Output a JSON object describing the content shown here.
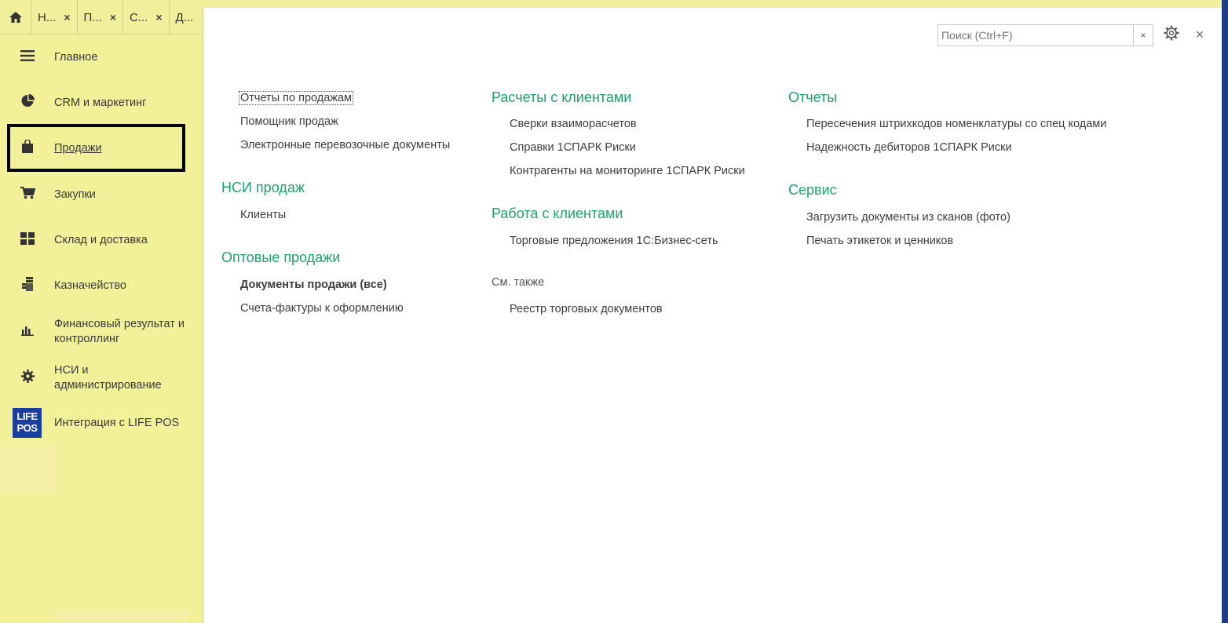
{
  "tabs": [
    {
      "label": "Н...",
      "close": "×"
    },
    {
      "label": "П...",
      "close": "×"
    },
    {
      "label": "С...",
      "close": "×"
    },
    {
      "label": "Д..."
    }
  ],
  "sidebar": {
    "items": [
      {
        "label": "Главное",
        "icon": "menu-icon"
      },
      {
        "label": "CRM и маркетинг",
        "icon": "pie-chart-icon"
      },
      {
        "label": "Продажи",
        "icon": "shopping-bag-icon",
        "active": true
      },
      {
        "label": "Закупки",
        "icon": "shopping-cart-icon"
      },
      {
        "label": "Склад и доставка",
        "icon": "warehouse-icon"
      },
      {
        "label": "Казначейство",
        "icon": "coins-icon"
      },
      {
        "label": "Финансовый результат и контроллинг",
        "icon": "bar-chart-icon"
      },
      {
        "label": "НСИ и администрирование",
        "icon": "gear-icon"
      },
      {
        "label": "Интеграция с LIFE POS",
        "icon": "life-pos-logo",
        "logo_text": "LIFE POS"
      }
    ]
  },
  "search": {
    "placeholder": "Поиск (Ctrl+F)",
    "clear": "×"
  },
  "main": {
    "close": "×",
    "col1": {
      "links_top": [
        "Отчеты по продажам",
        "Помощник продаж",
        "Электронные перевозочные документы"
      ],
      "nsi_title": "НСИ продаж",
      "nsi_links": [
        "Клиенты"
      ],
      "wholesale_title": "Оптовые продажи",
      "wholesale_links": [
        "Документы продажи (все)",
        "Счета-фактуры к оформлению"
      ]
    },
    "col2": {
      "settlements_title": "Расчеты с клиентами",
      "settlements_links": [
        "Сверки взаиморасчетов",
        "Справки 1СПАРК Риски",
        "Контрагенты на мониторинге 1СПАРК Риски"
      ],
      "work_title": "Работа с клиентами",
      "work_links": [
        "Торговые предложения 1С:Бизнес-сеть"
      ],
      "see_also": "См. также",
      "see_also_links": [
        "Реестр торговых документов"
      ]
    },
    "col3": {
      "reports_title": "Отчеты",
      "reports_links": [
        "Пересечения штрихкодов номенклатуры со спец кодами",
        "Надежность дебиторов 1СПАРК Риски"
      ],
      "service_title": "Сервис",
      "service_links": [
        "Загрузить документы из сканов (фото)",
        "Печать этикеток и ценников"
      ]
    }
  },
  "colors": {
    "sidebar_bg": "#f3f09a",
    "section_title": "#22a06b",
    "frame": "#1f3c86",
    "logo_bg": "#1b3ea0"
  }
}
